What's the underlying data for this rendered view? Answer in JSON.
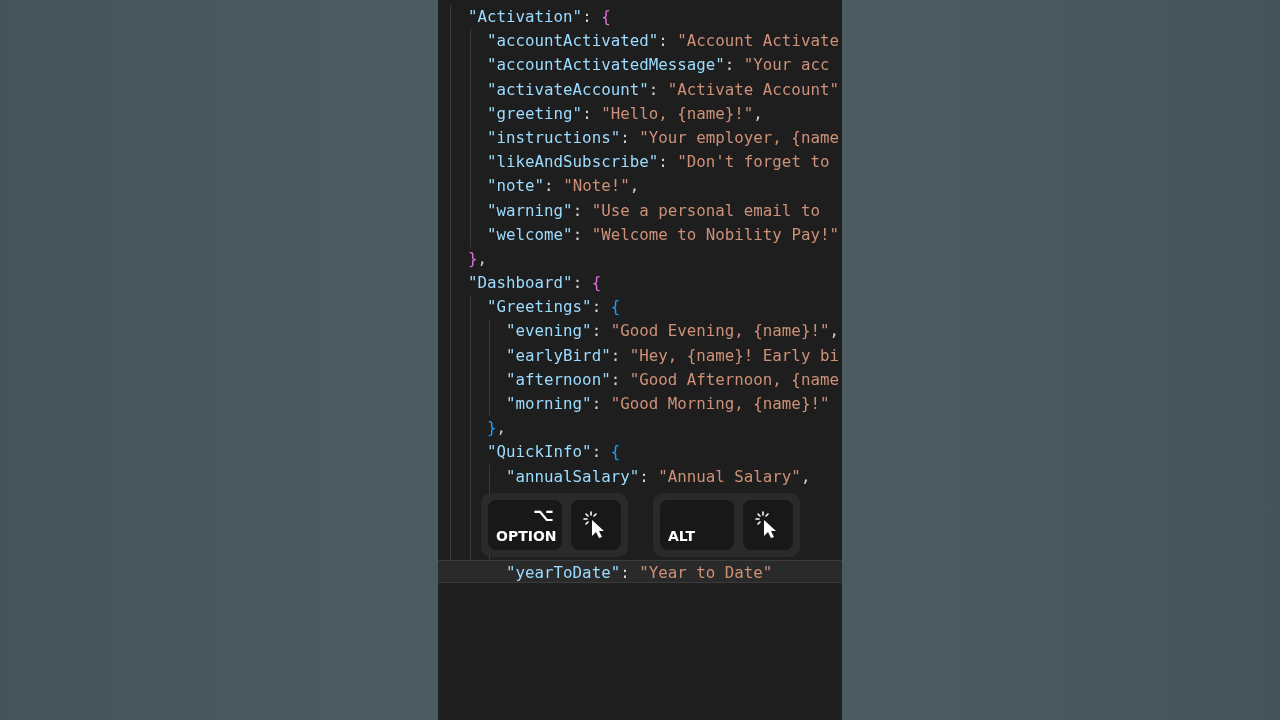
{
  "editor": {
    "entries": [
      {
        "key": "\"Activation\"",
        "colon": ":",
        "open": "{",
        "close": "}",
        "trail": ",",
        "children": [
          {
            "key": "\"accountActivated\"",
            "colon": ":",
            "value": "\"Account Activate"
          },
          {
            "key": "\"accountActivatedMessage\"",
            "colon": ":",
            "value": "\"Your acc"
          },
          {
            "key": "\"activateAccount\"",
            "colon": ":",
            "value": "\"Activate Account\""
          },
          {
            "key": "\"greeting\"",
            "colon": ":",
            "value": "\"Hello, {name}!\"",
            "trail": ","
          },
          {
            "key": "\"instructions\"",
            "colon": ":",
            "value": "\"Your employer, {name"
          },
          {
            "key": "\"likeAndSubscribe\"",
            "colon": ":",
            "value": "\"Don't forget to"
          },
          {
            "key": "\"note\"",
            "colon": ":",
            "value": "\"Note!\"",
            "trail": ","
          },
          {
            "key": "\"warning\"",
            "colon": ":",
            "value": "\"Use a personal email to"
          },
          {
            "key": "\"welcome\"",
            "colon": ":",
            "value": "\"Welcome to Nobility Pay!\""
          }
        ]
      },
      {
        "key": "\"Dashboard\"",
        "colon": ":",
        "open": "{",
        "children": [
          {
            "key": "\"Greetings\"",
            "colon": ":",
            "open": "{",
            "close": "}",
            "trail": ",",
            "children": [
              {
                "key": "\"evening\"",
                "colon": ":",
                "value": "\"Good Evening, {name}!\"",
                "trail": ","
              },
              {
                "key": "\"earlyBird\"",
                "colon": ":",
                "value": "\"Hey, {name}! Early bi"
              },
              {
                "key": "\"afternoon\"",
                "colon": ":",
                "value": "\"Good Afternoon, {name"
              },
              {
                "key": "\"morning\"",
                "colon": ":",
                "value": "\"Good Morning, {name}!\""
              }
            ]
          },
          {
            "key": "\"QuickInfo\"",
            "colon": ":",
            "open": "{",
            "children": [
              {
                "key": "\"annualSalary\"",
                "colon": ":",
                "value": "\"Annual Salary\"",
                "trail": ",",
                "active": false
              },
              {
                "kind": "keystrokes",
                "active": false,
                "combos": [
                  {
                    "label": "OPTION",
                    "symbol": "⌥"
                  },
                  {
                    "label": "ALT"
                  }
                ]
              },
              {
                "key": "\"yearToDate\"",
                "colon": ":",
                "value": "\"Year to Date\"",
                "active": true
              }
            ]
          }
        ]
      }
    ]
  }
}
